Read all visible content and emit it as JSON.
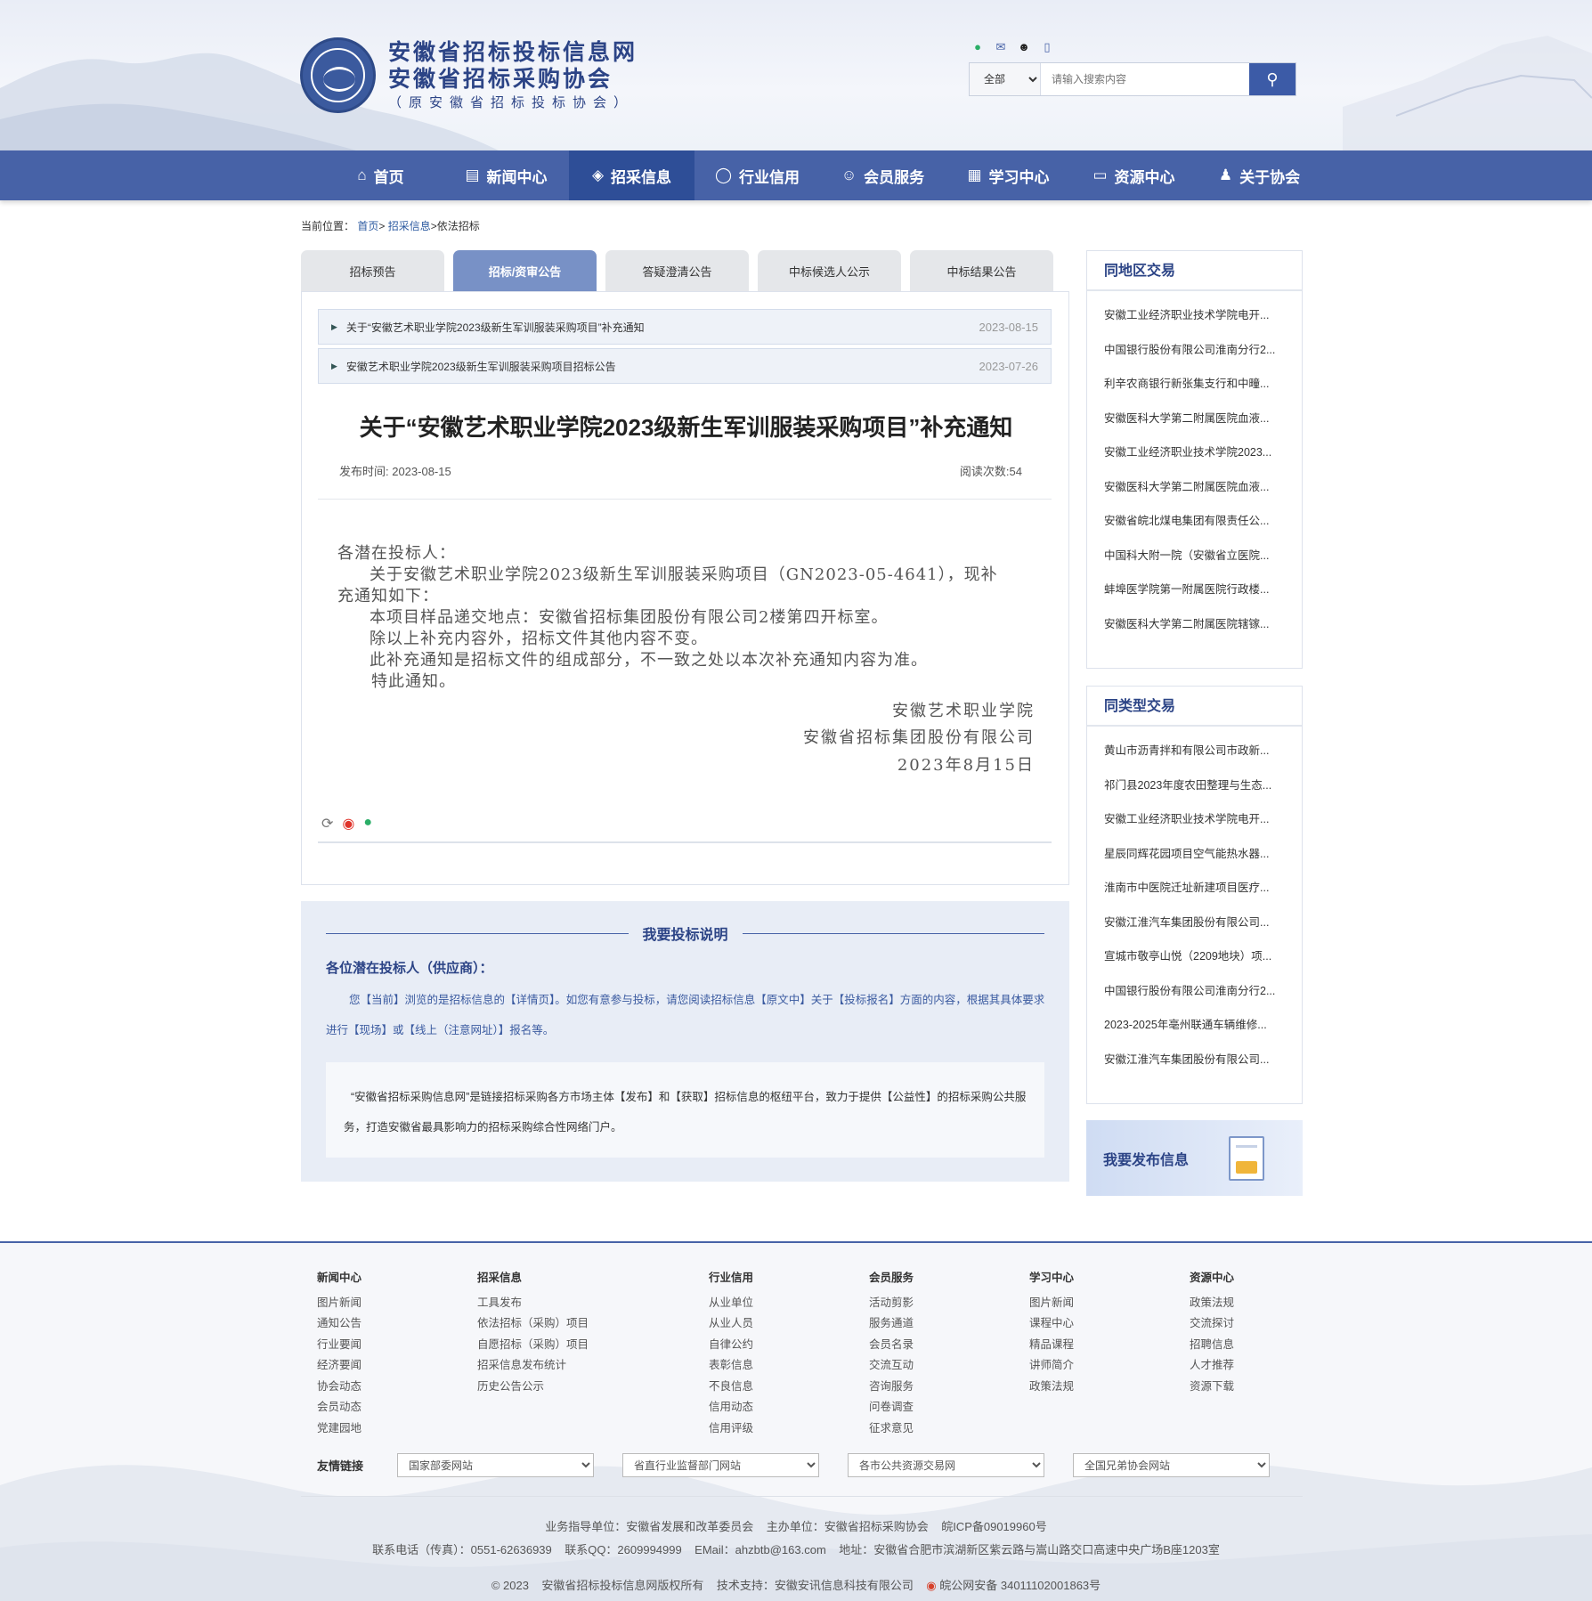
{
  "header": {
    "logo_line1": "安徽省招标投标信息网",
    "logo_line2": "安徽省招标采购协会",
    "logo_line3": "（原安徽省招标投标协会）",
    "social_icons": [
      "wechat-icon",
      "mail-icon",
      "qq-icon",
      "mobile-icon"
    ],
    "search_scope": "全部",
    "search_placeholder": "请输入搜索内容"
  },
  "nav": [
    {
      "label": "首页",
      "icon": "home-icon"
    },
    {
      "label": "新闻中心",
      "icon": "news-icon"
    },
    {
      "label": "招采信息",
      "icon": "layers-icon",
      "active": true
    },
    {
      "label": "行业信用",
      "icon": "credit-icon"
    },
    {
      "label": "会员服务",
      "icon": "member-icon"
    },
    {
      "label": "学习中心",
      "icon": "book-icon"
    },
    {
      "label": "资源中心",
      "icon": "folder-icon"
    },
    {
      "label": "关于协会",
      "icon": "about-icon"
    }
  ],
  "breadcrumb": {
    "prefix": "当前位置：",
    "home": "首页",
    "sep": ">",
    "section": "招采信息",
    "current": "依法招标"
  },
  "tabs": [
    "招标预告",
    "招标/资审公告",
    "答疑澄清公告",
    "中标候选人公示",
    "中标结果公告"
  ],
  "notices": [
    {
      "title": "关于“安徽艺术职业学院2023级新生军训服装采购项目”补充通知",
      "date": "2023-08-15"
    },
    {
      "title": "安徽艺术职业学院2023级新生军训服装采购项目招标公告",
      "date": "2023-07-26"
    }
  ],
  "article": {
    "title": "关于“安徽艺术职业学院2023级新生军训服装采购项目”补充通知",
    "publish_time": "发布时间: 2023-08-15",
    "read_count": "阅读次数:54",
    "greeting": "各潜在投标人：",
    "p1a": "关于安徽艺术职业学院2023级新生军训服装采购项目（GN2023-05-4641），现补",
    "p1b": "充通知如下：",
    "p2": "本项目样品递交地点：安徽省招标集团股份有限公司2楼第四开标室。",
    "p3": "除以上补充内容外，招标文件其他内容不变。",
    "p4": "此补充通知是招标文件的组成部分，不一致之处以本次补充通知内容为准。",
    "p5": "特此通知。",
    "sign1": "安徽艺术职业学院",
    "sign2": "安徽省招标集团股份有限公司",
    "sign3": "2023年8月15日"
  },
  "bid_info": {
    "title": "我要投标说明",
    "subtitle": "各位潜在投标人（供应商）：",
    "desc": "您【当前】浏览的是招标信息的【详情页】。如您有意参与投标，请您阅读招标信息【原文中】关于【投标报名】方面的内容，根据其具体要求进行【现场】或【线上（注意网址）】报名等。",
    "box": "“安徽省招标采购信息网”是链接招标采购各方市场主体【发布】和【获取】招标信息的枢纽平台，致力于提供【公益性】的招标采购公共服务，打造安徽省最具影响力的招标采购综合性网络门户。"
  },
  "side_local": {
    "title": "同地区交易",
    "items": [
      "安徽工业经济职业技术学院电开...",
      "中国银行股份有限公司淮南分行2...",
      "利辛农商银行新张集支行和中疃...",
      "安徽医科大学第二附属医院血液...",
      "安徽工业经济职业技术学院2023...",
      "安徽医科大学第二附属医院血液...",
      "安徽省皖北煤电集团有限责任公...",
      "中国科大附一院（安徽省立医院...",
      "蚌埠医学院第一附属医院行政楼...",
      "安徽医科大学第二附属医院辖镓..."
    ]
  },
  "side_type": {
    "title": "同类型交易",
    "items": [
      "黄山市沥青拌和有限公司市政新...",
      "祁门县2023年度农田整理与生态...",
      "安徽工业经济职业技术学院电开...",
      "星辰同辉花园项目空气能热水器...",
      "淮南市中医院迁址新建项目医疗...",
      "安徽江淮汽车集团股份有限公司...",
      "宣城市敬亭山悦（2209地块）项...",
      "中国银行股份有限公司淮南分行2...",
      "2023-2025年亳州联通车辆维修...",
      "安徽江淮汽车集团股份有限公司..."
    ]
  },
  "publish_label": "我要发布信息",
  "footer": {
    "cols": [
      {
        "title": "新闻中心",
        "items": [
          "图片新闻",
          "通知公告",
          "行业要闻",
          "经济要闻",
          "协会动态",
          "会员动态",
          "党建园地"
        ]
      },
      {
        "title": "招采信息",
        "items": [
          "工具发布",
          "依法招标（采购）项目",
          "自愿招标（采购）项目",
          "招采信息发布统计",
          "历史公告公示"
        ]
      },
      {
        "title": "行业信用",
        "items": [
          "从业单位",
          "从业人员",
          "自律公约",
          "表彰信息",
          "不良信息",
          "信用动态",
          "信用评级"
        ]
      },
      {
        "title": "会员服务",
        "items": [
          "活动剪影",
          "服务通道",
          "会员名录",
          "交流互动",
          "咨询服务",
          "问卷调查",
          "征求意见"
        ]
      },
      {
        "title": "学习中心",
        "items": [
          "图片新闻",
          "课程中心",
          "精品课程",
          "讲师简介",
          "政策法规"
        ]
      },
      {
        "title": "资源中心",
        "items": [
          "政策法规",
          "交流探讨",
          "招聘信息",
          "人才推荐",
          "资源下载"
        ]
      }
    ],
    "links_label": "友情链接",
    "links": [
      "国家部委网站",
      "省直行业监督部门网站",
      "各市公共资源交易网",
      "全国兄弟协会网站"
    ],
    "line1": "业务指导单位：安徽省发展和改革委员会    主办单位：安徽省招标采购协会    皖ICP备09019960号",
    "line2": "联系电话（传真）：0551-62636939    联系QQ：2609994999    EMail：ahzbtb@163.com    地址：安徽省合肥市滨湖新区紫云路与嵩山路交口高速中央广场B座1203室",
    "line3": "© 2023    安徽省招标投标信息网版权所有    技术支持：安徽安讯信息科技有限公司    ",
    "beian": "皖公网安备 34011102001863号"
  }
}
